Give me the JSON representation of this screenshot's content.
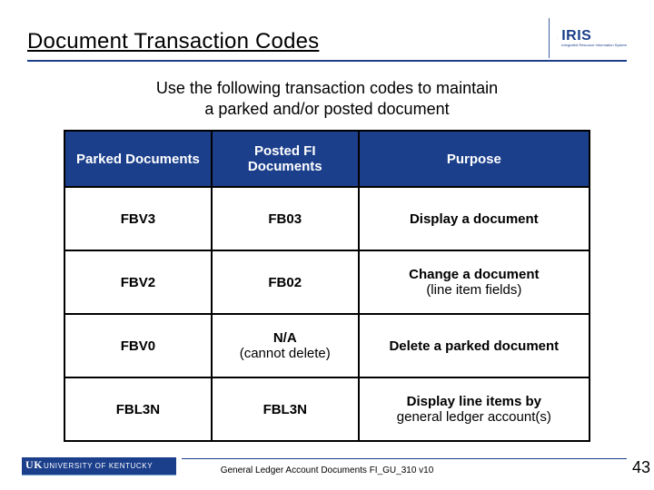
{
  "title": "Document Transaction Codes",
  "logo": {
    "name": "IRIS",
    "tagline": "Integrated Resource Information System"
  },
  "intro_line1": "Use the following transaction codes to maintain",
  "intro_line2": "a parked and/or posted document",
  "table": {
    "headers": {
      "col1": "Parked Documents",
      "col2": "Posted FI Documents",
      "col3": "Purpose"
    },
    "rows": [
      {
        "parked": "FBV3",
        "posted": "FB03",
        "posted_sub": "",
        "purpose": "Display a document",
        "purpose_sub": ""
      },
      {
        "parked": "FBV2",
        "posted": "FB02",
        "posted_sub": "",
        "purpose": "Change a document",
        "purpose_sub": "(line item fields)"
      },
      {
        "parked": "FBV0",
        "posted": "N/A",
        "posted_sub": "(cannot delete)",
        "purpose": "Delete a parked document",
        "purpose_sub": ""
      },
      {
        "parked": "FBL3N",
        "posted": "FBL3N",
        "posted_sub": "",
        "purpose": "Display line items by",
        "purpose_sub": "general ledger account(s)"
      }
    ]
  },
  "footer": {
    "org_mark": "UK",
    "org_name": "UNIVERSITY OF KENTUCKY",
    "doc_ref": "General Ledger Account Documents FI_GU_310 v10",
    "page": "43"
  }
}
